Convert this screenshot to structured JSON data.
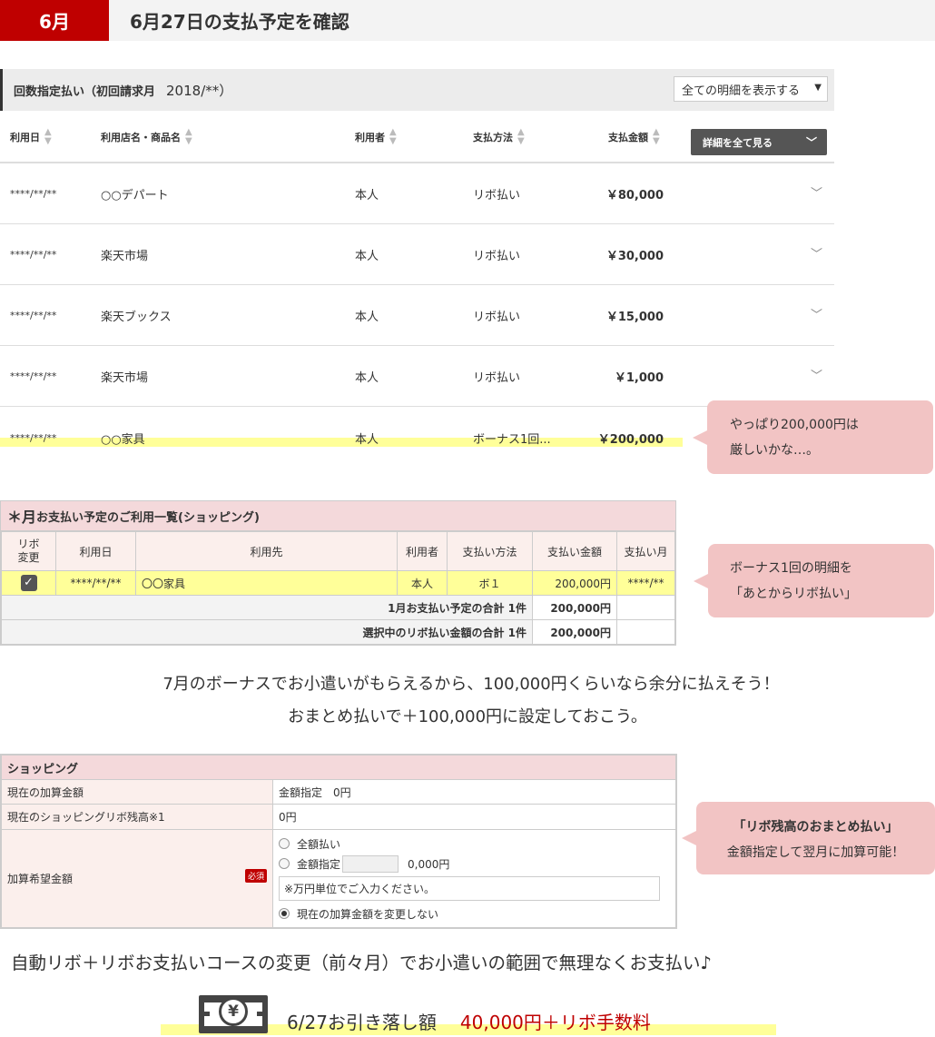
{
  "header": {
    "month": "6月",
    "title": "6月27日の支払予定を確認"
  },
  "statement": {
    "panel_label": "回数指定払い（初回請求月",
    "panel_year": "2018/**）",
    "filter_select": "全ての明細を表示する",
    "columns": [
      "利用日",
      "利用店名・商品名",
      "利用者",
      "支払方法",
      "支払金額"
    ],
    "detail_button": "詳細を全て見る",
    "rows": [
      {
        "date": "****/**/**",
        "shop": "○○デパート",
        "user": "本人",
        "method": "リボ払い",
        "amount": "￥80,000"
      },
      {
        "date": "****/**/**",
        "shop": "楽天市場",
        "user": "本人",
        "method": "リボ払い",
        "amount": "￥30,000"
      },
      {
        "date": "****/**/**",
        "shop": "楽天ブックス",
        "user": "本人",
        "method": "リボ払い",
        "amount": "￥15,000"
      },
      {
        "date": "****/**/**",
        "shop": "楽天市場",
        "user": "本人",
        "method": "リボ払い",
        "amount": "￥1,000"
      },
      {
        "date": "****/**/**",
        "shop": "○○家具",
        "user": "本人",
        "method": "ボーナス1回...",
        "amount": "￥200,000"
      }
    ]
  },
  "bubbles": {
    "b1": [
      "やっぱり200,000円は",
      "厳しいかな…。"
    ],
    "b2": [
      "ボーナス1回の明細を",
      "「あとからリボ払い」"
    ],
    "b3": [
      "「リボ残高のおまとめ払い」",
      "金額指定して翌月に加算可能！"
    ]
  },
  "revo_list": {
    "title_big": "＊月",
    "title_rest": "お支払い予定のご利用一覧(ショッピング)",
    "columns": [
      "リボ\n変更",
      "利用日",
      "利用先",
      "利用者",
      "支払い方法",
      "支払い金額",
      "支払い月"
    ],
    "row": {
      "date": "****/**/**",
      "shop": "〇〇家具",
      "user": "本人",
      "method": "ボ１",
      "amount": "200,000円",
      "month": "****/**"
    },
    "sum1_label": "1月お支払い予定の合計 1件",
    "sum1_value": "200,000円",
    "sum2_label": "選択中のリボ払い金額の合計 1件",
    "sum2_value": "200,000円"
  },
  "middle_text": [
    "7月のボーナスでお小遣いがもらえるから、100,000円くらいなら余分に払えそう！",
    "おまとめ払いで＋100,000円に設定しておこう。"
  ],
  "shopping_form": {
    "title": "ショッピング",
    "current_add_label": "現在の加算金額",
    "current_add_value": "金額指定　0円",
    "balance_label": "現在のショッピングリボ残高※1",
    "balance_value": "0円",
    "desired_label": "加算希望金額",
    "required": "必須",
    "opt_full": "全額払い",
    "opt_amount": "金額指定",
    "amount_suffix": "0,000円",
    "note": "※万円単位でご入力ください。",
    "opt_keep": "現在の加算金額を変更しない"
  },
  "bottom_text": "自動リボ＋リボお支払いコースの変更（前々月）でお小遣いの範囲で無理なくお支払い♪",
  "withdrawal": {
    "label": "6/27お引き落し額",
    "amount": "40,000円＋リボ手数料",
    "yen": "¥"
  },
  "colors": {
    "brand_red": "#bf0000",
    "highlight": "#ffff99",
    "bubble": "#f2c4c4",
    "table_head": "#f4d9db"
  }
}
